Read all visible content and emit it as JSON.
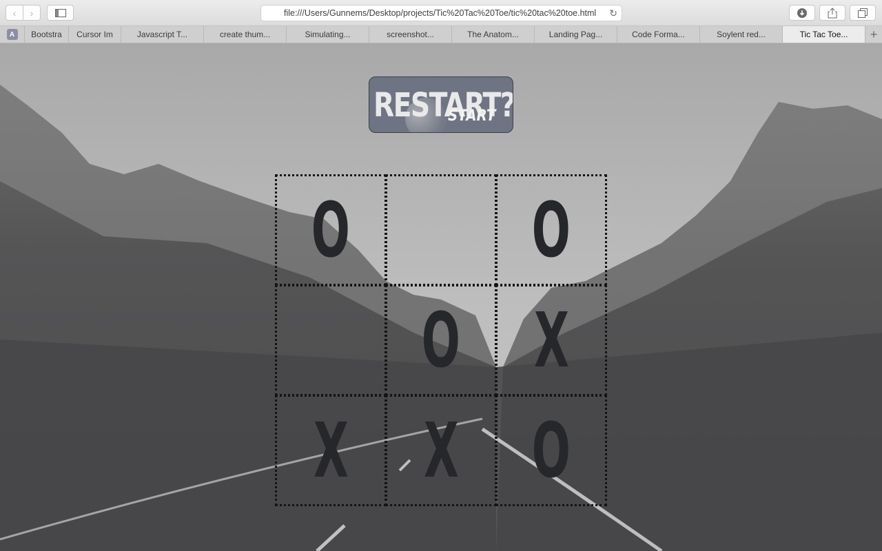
{
  "browser": {
    "url": "file:///Users/Gunnems/Desktop/projects/Tic%20Tac%20Toe/tic%20tac%20toe.html",
    "tabs": [
      {
        "label": "Bootstra",
        "active": false
      },
      {
        "label": "Cursor Im",
        "active": false
      },
      {
        "label": "Javascript T...",
        "active": false
      },
      {
        "label": "create thum...",
        "active": false
      },
      {
        "label": "Simulating...",
        "active": false
      },
      {
        "label": "screenshot...",
        "active": false
      },
      {
        "label": "The Anatom...",
        "active": false
      },
      {
        "label": "Landing Pag...",
        "active": false
      },
      {
        "label": "Code Forma...",
        "active": false
      },
      {
        "label": "Soylent red...",
        "active": false
      },
      {
        "label": "Tic Tac Toe...",
        "active": true
      }
    ],
    "pinned_tab": "A",
    "icons": {
      "back": "chevron-left-icon",
      "forward": "chevron-right-icon",
      "sidebar": "sidebar-icon",
      "reload": "reload-icon",
      "download": "download-icon",
      "share": "share-icon",
      "tabs": "tabs-overview-icon",
      "new_tab": "plus-icon"
    }
  },
  "game": {
    "restart_label": "RESTART?",
    "restart_sublabel": "START",
    "board": [
      [
        "O",
        "",
        "O"
      ],
      [
        "",
        "O",
        "X"
      ],
      [
        "X",
        "X",
        "O"
      ]
    ]
  },
  "colors": {
    "mark": "#25272b",
    "grid": "#141414",
    "button_bg": "#6e7483"
  }
}
